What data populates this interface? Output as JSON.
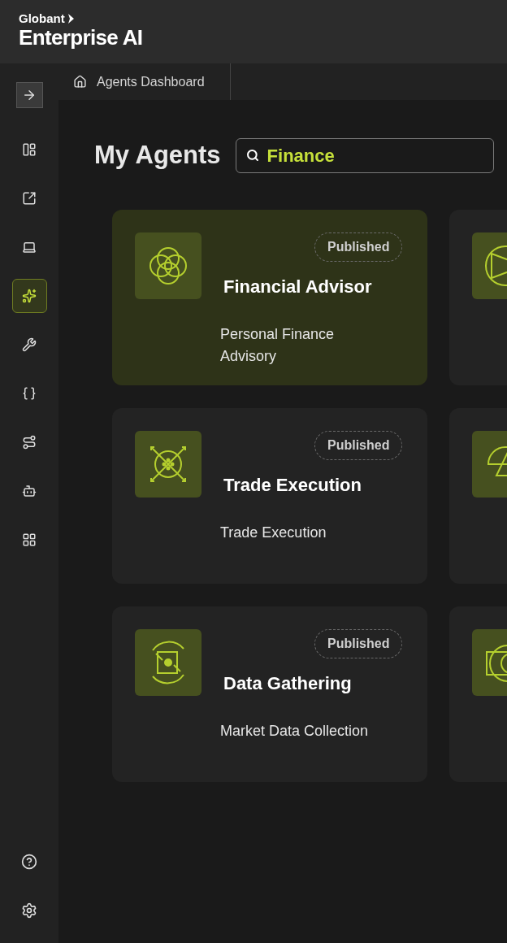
{
  "header": {
    "brand": "Globant",
    "product": "Enterprise AI"
  },
  "breadcrumb": {
    "label": "Agents Dashboard"
  },
  "sidebar": {
    "items": [
      {
        "selected": false
      },
      {
        "selected": false
      },
      {
        "selected": false
      },
      {
        "selected": true
      },
      {
        "selected": false
      },
      {
        "selected": false
      },
      {
        "selected": false
      },
      {
        "selected": false
      },
      {
        "selected": false
      }
    ]
  },
  "page": {
    "title": "My Agents",
    "search": {
      "value": "Finance"
    }
  },
  "agents": [
    {
      "name": "Financial Advisor",
      "status": "Published",
      "description": "Personal Finance Advisory",
      "selected": true
    },
    {
      "selected": false
    },
    {
      "name": "Trade Execution",
      "status": "Published",
      "description": "Trade Execution",
      "selected": false
    },
    {
      "selected": false
    },
    {
      "name": "Data Gathering",
      "status": "Published",
      "description": "Market Data Collection",
      "selected": false
    },
    {
      "selected": false
    }
  ]
}
